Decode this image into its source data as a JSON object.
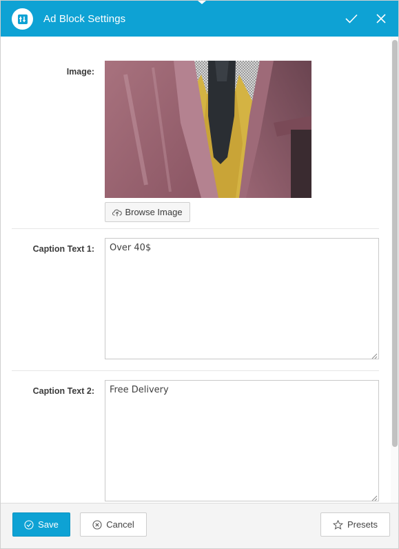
{
  "header": {
    "title": "Ad Block Settings",
    "icon": "ad-block-icon",
    "confirm_icon": "checkmark-icon",
    "close_icon": "close-icon",
    "background_color": "#0ea2d4"
  },
  "fields": {
    "image": {
      "label": "Image:",
      "browse_label": "Browse Image",
      "browse_icon": "cloud-upload-icon"
    },
    "caption_1": {
      "label": "Caption Text 1:",
      "value": "Over 40$"
    },
    "caption_2": {
      "label": "Caption Text 2:",
      "value": "Free Delivery"
    }
  },
  "footer": {
    "save_label": "Save",
    "save_icon": "check-circle-icon",
    "cancel_label": "Cancel",
    "cancel_icon": "close-circle-icon",
    "presets_label": "Presets",
    "presets_icon": "star-icon"
  }
}
